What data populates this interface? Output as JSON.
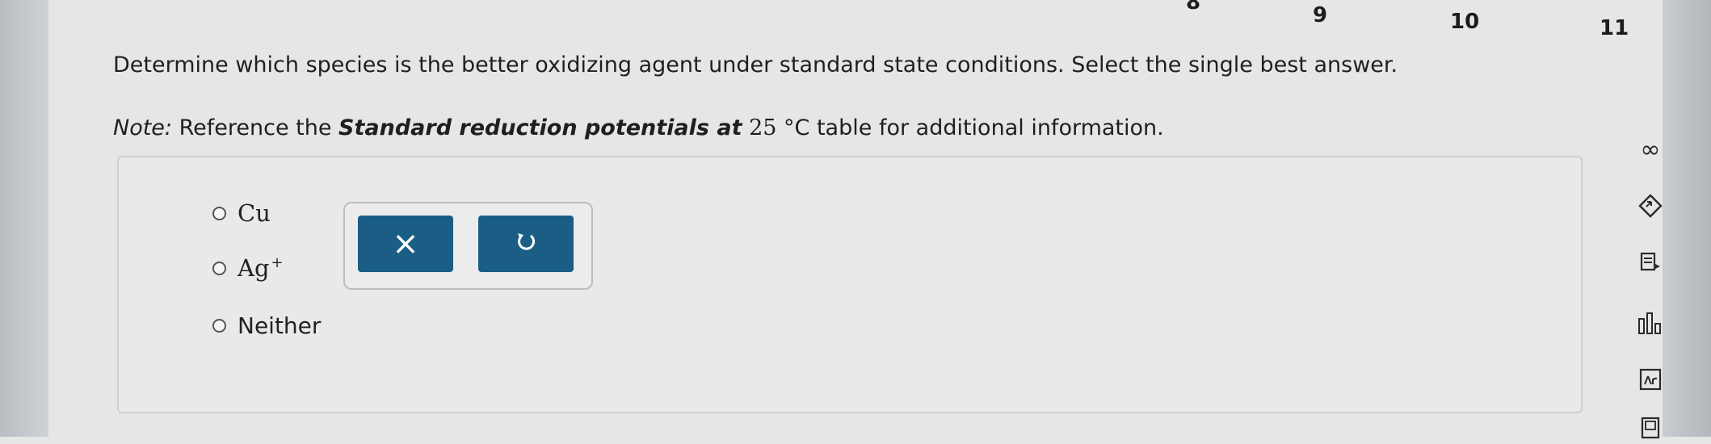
{
  "page_nav": {
    "numbers": [
      "8",
      "9",
      "10",
      "11"
    ]
  },
  "question": {
    "prompt": "Determine which species is the better oxidizing agent under standard state conditions. Select the single best answer.",
    "note_label": "Note:",
    "note_pre": " Reference the ",
    "note_table": "Standard reduction potentials at",
    "note_temp": " 25 ",
    "note_unit": "°C",
    "note_post": " table for additional information."
  },
  "options": [
    {
      "label": "Cu",
      "sup": ""
    },
    {
      "label": "Ag",
      "sup": "+"
    },
    {
      "label": "Neither",
      "sup": ""
    }
  ],
  "actions": {
    "clear_icon": "×",
    "undo_icon": "undo-icon"
  },
  "tools": {
    "infinity_icon": "∞"
  },
  "colors": {
    "accent": "#1a5e86"
  }
}
